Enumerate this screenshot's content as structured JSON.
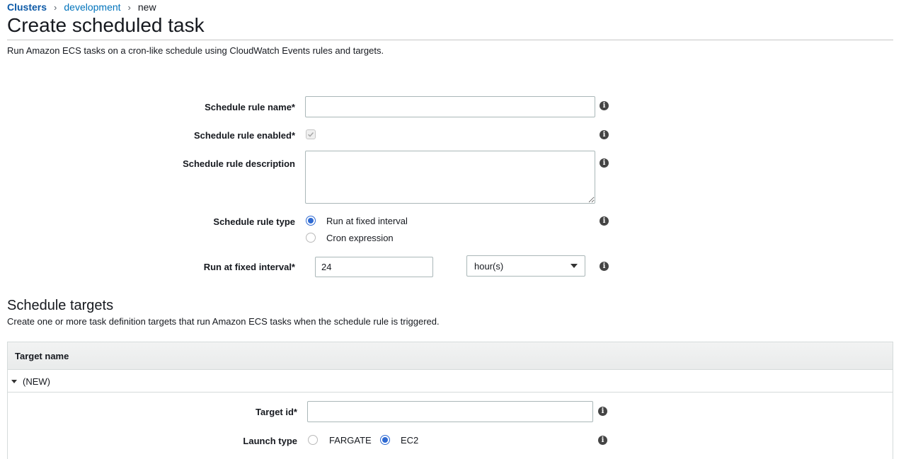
{
  "breadcrumb": {
    "clusters": "Clusters",
    "cluster": "development",
    "current": "new",
    "sep": "›"
  },
  "page": {
    "title": "Create scheduled task",
    "description": "Run Amazon ECS tasks on a cron-like schedule using CloudWatch Events rules and targets."
  },
  "form": {
    "rule_name_label": "Schedule rule name*",
    "rule_name_value": "",
    "rule_enabled_label": "Schedule rule enabled*",
    "rule_enabled_checked": true,
    "rule_description_label": "Schedule rule description",
    "rule_description_value": "",
    "rule_type_label": "Schedule rule type",
    "rule_type_options": [
      "Run at fixed interval",
      "Cron expression"
    ],
    "rule_type_selected": "Run at fixed interval",
    "fixed_interval_label": "Run at fixed interval*",
    "fixed_interval_value": "24",
    "interval_unit": "hour(s)",
    "info_glyph": "i"
  },
  "targets": {
    "title": "Schedule targets",
    "description": "Create one or more task definition targets that run Amazon ECS tasks when the schedule rule is triggered.",
    "table_header": "Target name",
    "row_label": "(NEW)",
    "target_id_label": "Target id*",
    "target_id_value": "",
    "launch_type_label": "Launch type",
    "launch_type_options": [
      "FARGATE",
      "EC2"
    ],
    "launch_type_selected": "EC2"
  },
  "colors": {
    "link": "#0073bb",
    "radio_selected": "#2f6ad2",
    "table_header_bg": "#f2f3f3"
  }
}
